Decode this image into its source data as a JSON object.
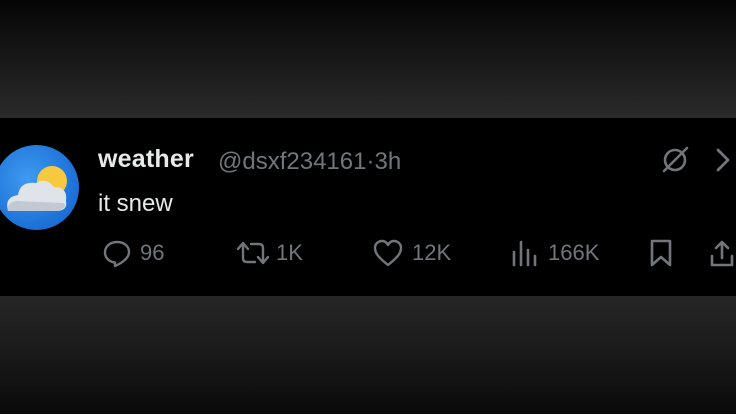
{
  "tweet": {
    "display_name": "weather",
    "handle": "@dsxf234161",
    "separator": "·",
    "time": "3h",
    "text": "it snew"
  },
  "actions": {
    "replies": "96",
    "reposts": "1K",
    "likes": "12K",
    "views": "166K"
  },
  "icons": {
    "avatar": "weather-cloud-sun-icon",
    "grok": "grok-icon",
    "more": "chevron-right-icon",
    "reply": "reply-icon",
    "repost": "repost-icon",
    "like": "heart-icon",
    "views": "views-icon",
    "bookmark": "bookmark-icon",
    "share": "share-icon"
  },
  "colors": {
    "background": "#000000",
    "primary_text": "#e7e9ea",
    "secondary_text": "#71767b",
    "avatar_blue": "#1b6fd6"
  }
}
